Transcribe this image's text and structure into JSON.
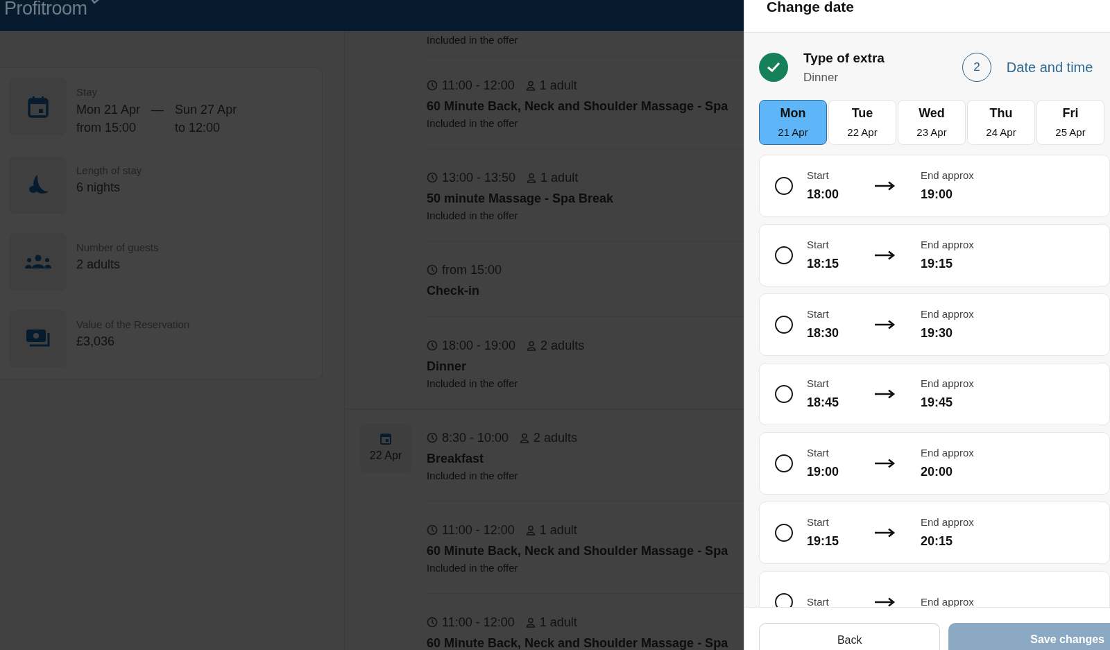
{
  "header": {
    "logo": "Profitroom"
  },
  "summary": [
    {
      "kind": "stay",
      "label": "Stay",
      "from_date": "Mon 21 Apr",
      "from_time": "from 15:00",
      "separator": "—",
      "to_date": "Sun 27 Apr",
      "to_time": "to 12:00"
    },
    {
      "kind": "nights",
      "label": "Length of stay",
      "value": "6 nights"
    },
    {
      "kind": "guests",
      "label": "Number of guests",
      "value": "2 adults"
    },
    {
      "kind": "money",
      "label": "Value of the Reservation",
      "value": "£3,036"
    }
  ],
  "timeline": [
    {
      "items": [
        {
          "note": "Included in the offer"
        },
        {
          "time": "11:00 - 12:00",
          "guests": "1 adult",
          "title": "60 Minute Back, Neck and Shoulder Massage - Spa",
          "note": "Included in the offer"
        },
        {
          "time": "13:00 - 13:50",
          "guests": "1 adult",
          "title": "50 minute Massage - Spa Break",
          "note": "Included in the offer"
        },
        {
          "time": "from 15:00",
          "title": "Check-in"
        },
        {
          "time": "18:00 - 19:00",
          "guests": "2 adults",
          "title": "Dinner",
          "note": "Included in the offer"
        }
      ]
    },
    {
      "date": "22 Apr",
      "items": [
        {
          "time": "8:30 - 10:00",
          "guests": "2 adults",
          "title": "Breakfast",
          "note": "Included in the offer"
        },
        {
          "time": "11:00 - 12:00",
          "guests": "1 adult",
          "title": "60 Minute Back, Neck and Shoulder Massage - Spa",
          "note": "Included in the offer"
        },
        {
          "time": "11:00 - 12:00",
          "guests": "1 adult",
          "title": "60 Minute Back, Neck and Shoulder Massage - Spa"
        }
      ]
    }
  ],
  "drawer": {
    "title": "Change date",
    "steps": [
      {
        "done": true,
        "title": "Type of extra",
        "subtitle": "Dinner"
      },
      {
        "done": false,
        "number": "2",
        "title": "Date and time"
      }
    ],
    "days": [
      {
        "weekday": "Mon",
        "date": "21 Apr",
        "selected": true
      },
      {
        "weekday": "Tue",
        "date": "22 Apr",
        "selected": false
      },
      {
        "weekday": "Wed",
        "date": "23 Apr",
        "selected": false
      },
      {
        "weekday": "Thu",
        "date": "24 Apr",
        "selected": false
      },
      {
        "weekday": "Fri",
        "date": "25 Apr",
        "selected": false
      }
    ],
    "slots": [
      {
        "start_label": "Start",
        "start": "18:00",
        "end_label": "End approx",
        "end": "19:00",
        "selected": false
      },
      {
        "start_label": "Start",
        "start": "18:15",
        "end_label": "End approx",
        "end": "19:15",
        "selected": false
      },
      {
        "start_label": "Start",
        "start": "18:30",
        "end_label": "End approx",
        "end": "19:30",
        "selected": false
      },
      {
        "start_label": "Start",
        "start": "18:45",
        "end_label": "End approx",
        "end": "19:45",
        "selected": false
      },
      {
        "start_label": "Start",
        "start": "19:00",
        "end_label": "End approx",
        "end": "20:00",
        "selected": false
      },
      {
        "start_label": "Start",
        "start": "19:15",
        "end_label": "End approx",
        "end": "20:15",
        "selected": false
      },
      {
        "start_label": "Start",
        "end_label": "End approx",
        "selected": false
      }
    ],
    "buttons": [
      {
        "kind": "back",
        "label": "Back",
        "disabled": false
      },
      {
        "kind": "save",
        "label": "Save changes",
        "disabled": true
      }
    ]
  }
}
